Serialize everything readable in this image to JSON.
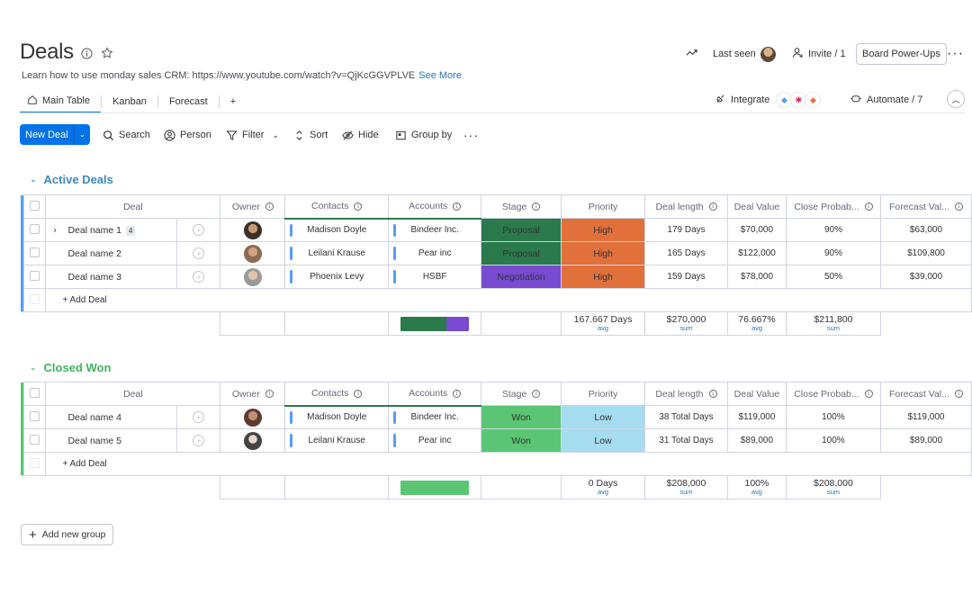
{
  "header": {
    "title": "Deals",
    "description": "Learn how to use monday sales CRM: https://www.youtube.com/watch?v=QjKcGGVPLVE",
    "see_more": "See More",
    "last_seen": "Last seen",
    "invite": "Invite / 1",
    "board_powerups": "Board Power-Ups"
  },
  "tabs": [
    {
      "label": "Main Table",
      "icon": "home-icon",
      "active": true
    },
    {
      "label": "Kanban"
    },
    {
      "label": "Forecast"
    }
  ],
  "tab_add": "+",
  "integrate": "Integrate",
  "automate": "Automate / 7",
  "toolbar": {
    "new_item": "New Deal",
    "search": "Search",
    "person": "Person",
    "filter": "Filter",
    "sort": "Sort",
    "hide": "Hide",
    "group_by": "Group by"
  },
  "columns": {
    "deal": "Deal",
    "owner": "Owner",
    "contacts": "Contacts",
    "accounts": "Accounts",
    "stage": "Stage",
    "priority": "Priority",
    "deal_length": "Deal length",
    "deal_value": "Deal Value",
    "close_prob": "Close Probab...",
    "forecast": "Forecast Val..."
  },
  "groups": [
    {
      "name": "Active Deals",
      "color": "#579bfc",
      "title_color": "#3a8ac9",
      "add_label": "+ Add Deal",
      "rows": [
        {
          "name": "Deal name 1",
          "subitems": "4",
          "owner_avatar": "av1",
          "contact": "Madison Doyle",
          "account": "Bindeer Inc.",
          "stage": "Proposal",
          "priority": "High",
          "deal_length": "179 Days",
          "deal_value": "$70,000",
          "close_prob": "90%",
          "forecast": "$63,000"
        },
        {
          "name": "Deal name 2",
          "owner_avatar": "av2",
          "contact": "Leilani Krause",
          "account": "Pear inc",
          "stage": "Proposal",
          "priority": "High",
          "deal_length": "165 Days",
          "deal_value": "$122,000",
          "close_prob": "90%",
          "forecast": "$109,800"
        },
        {
          "name": "Deal name 3",
          "owner_avatar": "av3",
          "contact": "Phoenix Levy",
          "account": "HSBF",
          "stage": "Negotiation",
          "priority": "High",
          "deal_length": "159 Days",
          "deal_value": "$78,000",
          "close_prob": "50%",
          "forecast": "$39,000"
        }
      ],
      "summary": {
        "deal_length": "167.667 Days",
        "deal_length_lbl": "avg",
        "deal_value": "$270,000",
        "deal_value_lbl": "sum",
        "close_prob": "76.667%",
        "close_prob_lbl": "avg",
        "forecast": "$211,800",
        "forecast_lbl": "sum"
      }
    },
    {
      "name": "Closed Won",
      "color": "#5ac674",
      "title_color": "#3fb561",
      "add_label": "+ Add Deal",
      "rows": [
        {
          "name": "Deal name 4",
          "owner_avatar": "av4",
          "contact": "Madison Doyle",
          "account": "Bindeer Inc.",
          "stage": "Won",
          "priority": "Low",
          "deal_length": "38 Total Days",
          "deal_value": "$119,000",
          "close_prob": "100%",
          "forecast": "$119,000"
        },
        {
          "name": "Deal name 5",
          "owner_avatar": "av5",
          "contact": "Leilani Krause",
          "account": "Pear inc",
          "stage": "Won",
          "priority": "Low",
          "deal_length": "31 Total Days",
          "deal_value": "$89,000",
          "close_prob": "100%",
          "forecast": "$89,000"
        }
      ],
      "summary": {
        "deal_length": "0 Days",
        "deal_length_lbl": "avg",
        "deal_value": "$208,000",
        "deal_value_lbl": "sum",
        "close_prob": "100%",
        "close_prob_lbl": "avg",
        "forecast": "$208,000",
        "forecast_lbl": "sum"
      }
    }
  ],
  "add_group": "Add new group",
  "colors": {
    "accent": "#0073ea",
    "proposal": "#2b7a4b",
    "negotiation": "#784bd1",
    "won": "#5ac674",
    "high": "#e2703a",
    "low": "#a6dcef"
  }
}
